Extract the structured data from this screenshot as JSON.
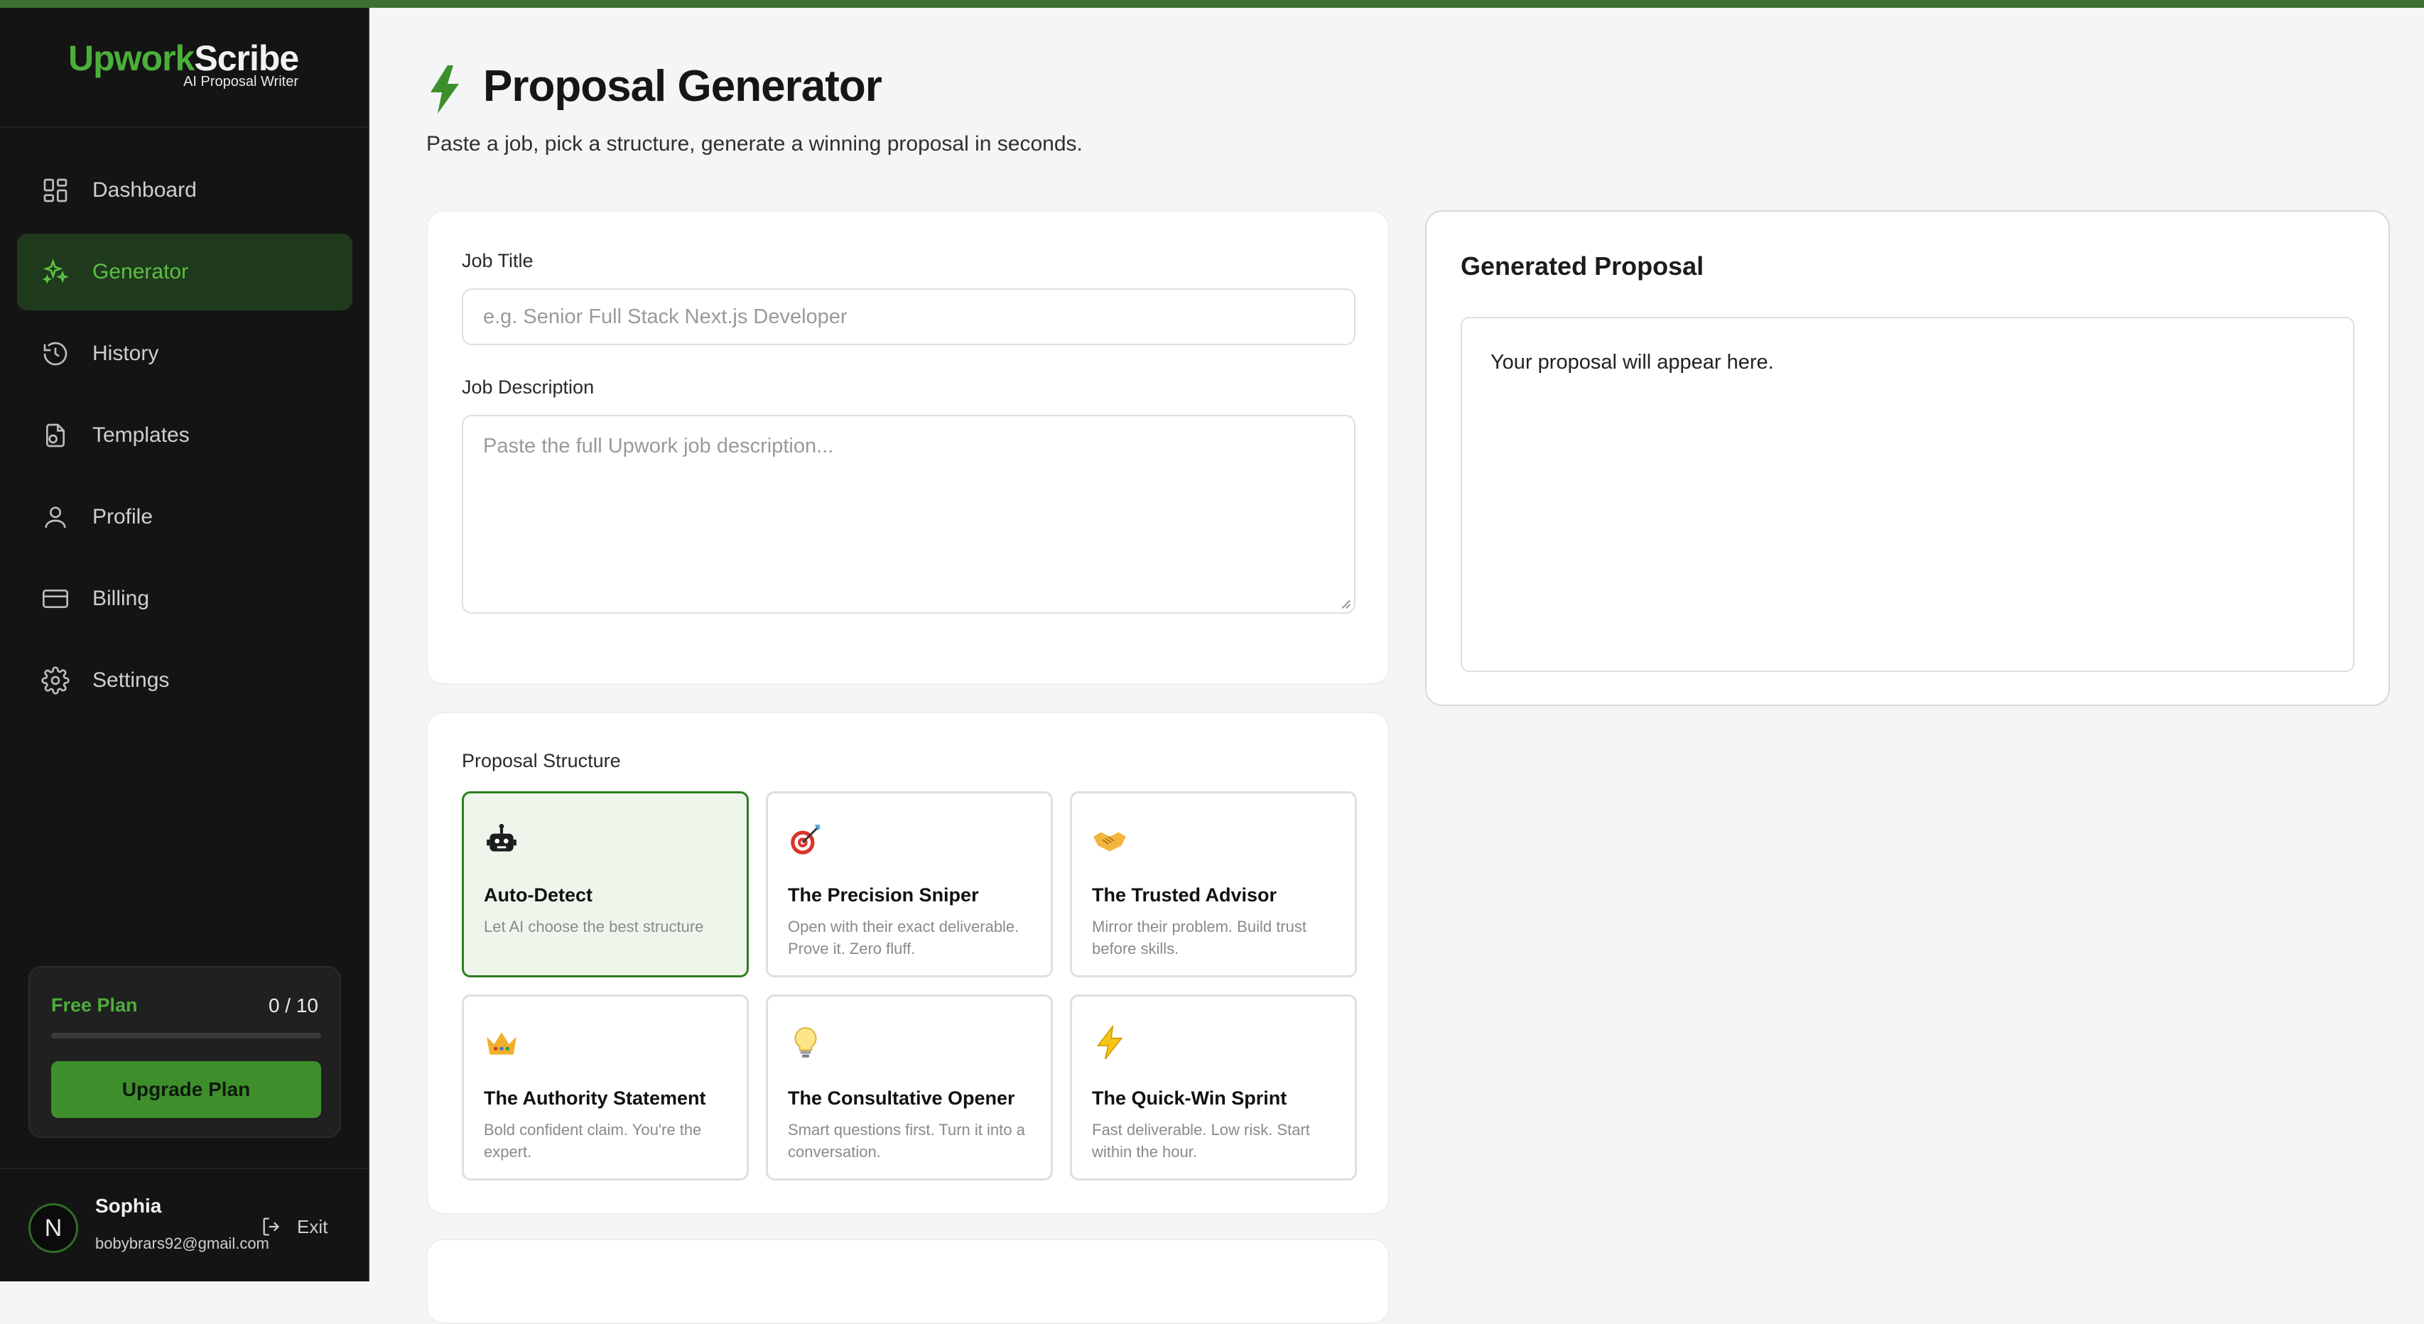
{
  "brand": {
    "logo_part1": "Upwork",
    "logo_part2": "Scribe",
    "tagline": "AI Proposal Writer"
  },
  "sidebar": {
    "items": [
      {
        "label": "Dashboard",
        "icon": "grid-icon",
        "active": false
      },
      {
        "label": "Generator",
        "icon": "sparkle-icon",
        "active": true
      },
      {
        "label": "History",
        "icon": "history-icon",
        "active": false
      },
      {
        "label": "Templates",
        "icon": "templates-icon",
        "active": false
      },
      {
        "label": "Profile",
        "icon": "user-icon",
        "active": false
      },
      {
        "label": "Billing",
        "icon": "credit-card-icon",
        "active": false
      },
      {
        "label": "Settings",
        "icon": "gear-icon",
        "active": false
      }
    ],
    "plan": {
      "label": "Free Plan",
      "count": "0 / 10",
      "usage_fraction": 0,
      "upgrade_label": "Upgrade Plan"
    },
    "user": {
      "initial": "N",
      "name": "Sophia",
      "email": "bobybrars92@gmail.com",
      "exit_label": "Exit"
    }
  },
  "header": {
    "title": "Proposal Generator",
    "subtitle": "Paste a job, pick a structure, generate a winning proposal in seconds."
  },
  "form": {
    "job_title_label": "Job Title",
    "job_title_placeholder": "e.g. Senior Full Stack Next.js Developer",
    "job_title_value": "",
    "job_desc_label": "Job Description",
    "job_desc_placeholder": "Paste the full Upwork job description...",
    "job_desc_value": ""
  },
  "structure": {
    "label": "Proposal Structure",
    "options": [
      {
        "emoji": "🤖",
        "name": "Auto-Detect",
        "desc": "Let AI choose the best structure",
        "selected": true
      },
      {
        "emoji": "🎯",
        "name": "The Precision Sniper",
        "desc": "Open with their exact deliverable. Prove it. Zero fluff.",
        "selected": false
      },
      {
        "emoji": "🤝",
        "name": "The Trusted Advisor",
        "desc": "Mirror their problem. Build trust before skills.",
        "selected": false
      },
      {
        "emoji": "👑",
        "name": "The Authority Statement",
        "desc": "Bold confident claim. You're the expert.",
        "selected": false
      },
      {
        "emoji": "💡",
        "name": "The Consultative Opener",
        "desc": "Smart questions first. Turn it into a conversation.",
        "selected": false
      },
      {
        "emoji": "⚡",
        "name": "The Quick-Win Sprint",
        "desc": "Fast deliverable. Low risk. Start within the hour.",
        "selected": false
      }
    ]
  },
  "output": {
    "title": "Generated Proposal",
    "placeholder": "Your proposal will appear here."
  },
  "colors": {
    "accent": "#4caf3a",
    "accent_dark": "#3e8f2c",
    "sidebar_bg": "#141414",
    "page_bg": "#f4f5f7"
  }
}
